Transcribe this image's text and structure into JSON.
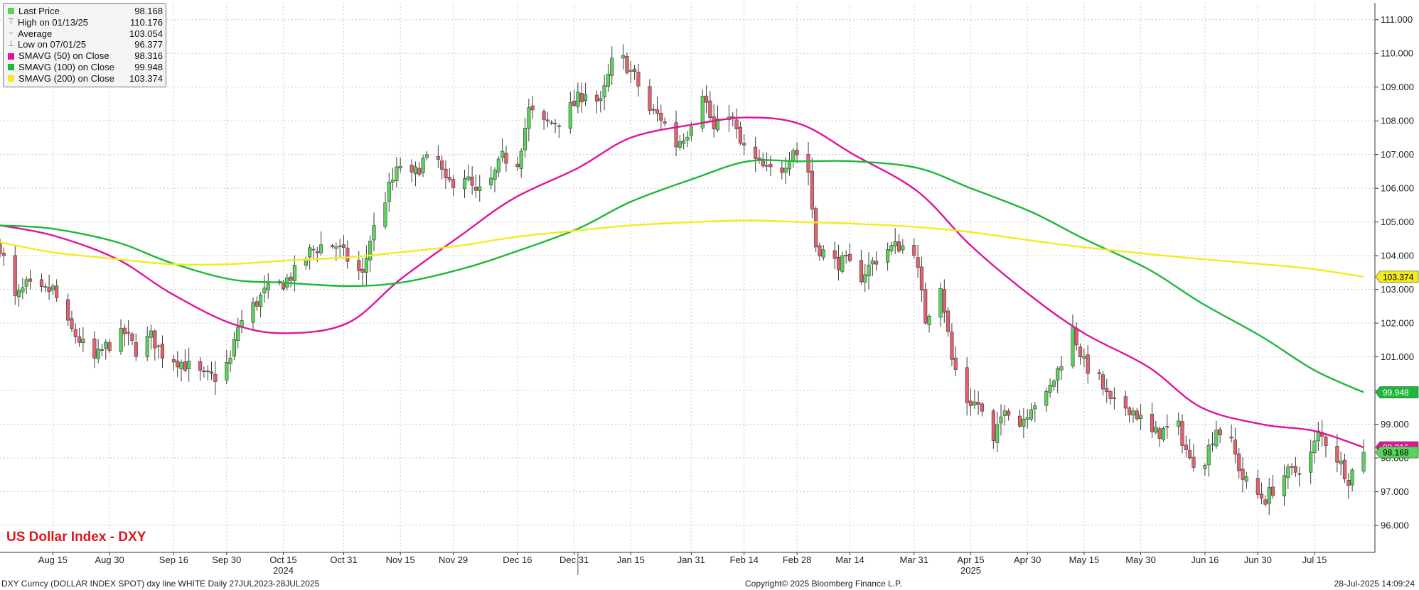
{
  "legend": {
    "items": [
      {
        "label": "Last Price",
        "value": "98.168",
        "color": "#5bd35b",
        "icon": "square"
      },
      {
        "label": "High on 01/13/25",
        "value": "110.176",
        "icon": "high-marker"
      },
      {
        "label": "Average",
        "value": "103.054",
        "icon": "average-marker"
      },
      {
        "label": "Low on 07/01/25",
        "value": "96.377",
        "icon": "low-marker"
      },
      {
        "label": "SMAVG (50)  on Close",
        "value": "98.316",
        "color": "#e0149a",
        "icon": "square"
      },
      {
        "label": "SMAVG (100)  on Close",
        "value": "99.948",
        "color": "#1cb83a",
        "icon": "square"
      },
      {
        "label": "SMAVG (200)  on Close",
        "value": "103.374",
        "color": "#f2ec1c",
        "icon": "square"
      }
    ]
  },
  "chart_title": "US Dollar Index - DXY",
  "footer": {
    "left": "DXY Curncy (DOLLAR INDEX SPOT) dxy line WHITE  Daily 27JUL2023-28JUL2025",
    "center": "Copyright© 2025 Bloomberg Finance L.P.",
    "right": "28-Jul-2025 14:09:24"
  },
  "colors": {
    "up": "#5bd35b",
    "down": "#e4606c",
    "sma50": "#e0149a",
    "sma100": "#1cb83a",
    "sma200": "#f2ec1c",
    "title": "#e0161d"
  },
  "chart_data": {
    "type": "candlestick",
    "title": "US Dollar Index - DXY",
    "ylim": [
      95.2,
      111.5
    ],
    "yticks": [
      "96.000",
      "97.000",
      "98.000",
      "99.000",
      "100.000",
      "101.000",
      "102.000",
      "103.000",
      "104.000",
      "105.000",
      "106.000",
      "107.000",
      "108.000",
      "109.000",
      "110.000",
      "111.000"
    ],
    "xlim": [
      "2024-08-01",
      "2025-07-31"
    ],
    "xticks": [
      {
        "date": "2024-08-15",
        "label": "Aug 15"
      },
      {
        "date": "2024-08-30",
        "label": "Aug 30"
      },
      {
        "date": "2024-09-16",
        "label": "Sep 16"
      },
      {
        "date": "2024-09-30",
        "label": "Sep 30"
      },
      {
        "date": "2024-10-15",
        "label": "Oct 15",
        "year": "2024"
      },
      {
        "date": "2024-10-31",
        "label": "Oct 31"
      },
      {
        "date": "2024-11-15",
        "label": "Nov 15"
      },
      {
        "date": "2024-11-29",
        "label": "Nov 29"
      },
      {
        "date": "2024-12-16",
        "label": "Dec 16"
      },
      {
        "date": "2024-12-31",
        "label": "Dec 31"
      },
      {
        "date": "2025-01-15",
        "label": "Jan 15"
      },
      {
        "date": "2025-01-31",
        "label": "Jan 31"
      },
      {
        "date": "2025-02-14",
        "label": "Feb 14"
      },
      {
        "date": "2025-02-28",
        "label": "Feb 28"
      },
      {
        "date": "2025-03-14",
        "label": "Mar 14"
      },
      {
        "date": "2025-03-31",
        "label": "Mar 31"
      },
      {
        "date": "2025-04-15",
        "label": "Apr 15",
        "year": "2025"
      },
      {
        "date": "2025-04-30",
        "label": "Apr 30"
      },
      {
        "date": "2025-05-15",
        "label": "May 15"
      },
      {
        "date": "2025-05-30",
        "label": "May 30"
      },
      {
        "date": "2025-06-16",
        "label": "Jun 16"
      },
      {
        "date": "2025-06-30",
        "label": "Jun 30"
      },
      {
        "date": "2025-07-15",
        "label": "Jul 15"
      }
    ],
    "close_anchors": [
      [
        "2024-08-01",
        104.3
      ],
      [
        "2024-08-05",
        102.7
      ],
      [
        "2024-08-08",
        103.1
      ],
      [
        "2024-08-12",
        102.9
      ],
      [
        "2024-08-15",
        103.0
      ],
      [
        "2024-08-19",
        101.9
      ],
      [
        "2024-08-22",
        101.5
      ],
      [
        "2024-08-26",
        100.9
      ],
      [
        "2024-08-29",
        101.3
      ],
      [
        "2024-09-03",
        101.7
      ],
      [
        "2024-09-06",
        101.2
      ],
      [
        "2024-09-10",
        101.6
      ],
      [
        "2024-09-13",
        101.1
      ],
      [
        "2024-09-17",
        100.9
      ],
      [
        "2024-09-20",
        100.7
      ],
      [
        "2024-09-24",
        100.4
      ],
      [
        "2024-09-27",
        100.4
      ],
      [
        "2024-10-01",
        100.9
      ],
      [
        "2024-10-03",
        101.9
      ],
      [
        "2024-10-07",
        102.5
      ],
      [
        "2024-10-10",
        102.9
      ],
      [
        "2024-10-15",
        103.2
      ],
      [
        "2024-10-18",
        103.5
      ],
      [
        "2024-10-22",
        104.1
      ],
      [
        "2024-10-25",
        104.3
      ],
      [
        "2024-10-29",
        104.3
      ],
      [
        "2024-11-01",
        103.9
      ],
      [
        "2024-11-05",
        103.4
      ],
      [
        "2024-11-07",
        104.5
      ],
      [
        "2024-11-12",
        106.0
      ],
      [
        "2024-11-15",
        106.7
      ],
      [
        "2024-11-18",
        106.3
      ],
      [
        "2024-11-21",
        106.8
      ],
      [
        "2024-11-25",
        106.8
      ],
      [
        "2024-11-27",
        106.1
      ],
      [
        "2024-12-02",
        106.4
      ],
      [
        "2024-12-05",
        105.8
      ],
      [
        "2024-12-09",
        106.2
      ],
      [
        "2024-12-12",
        106.9
      ],
      [
        "2024-12-16",
        106.8
      ],
      [
        "2024-12-19",
        108.3
      ],
      [
        "2024-12-23",
        107.9
      ],
      [
        "2024-12-27",
        108.0
      ],
      [
        "2024-12-31",
        108.5
      ],
      [
        "2025-01-03",
        108.9
      ],
      [
        "2025-01-07",
        108.5
      ],
      [
        "2025-01-10",
        109.7
      ],
      [
        "2025-01-13",
        109.8
      ],
      [
        "2025-01-16",
        109.3
      ],
      [
        "2025-01-20",
        108.3
      ],
      [
        "2025-01-23",
        108.1
      ],
      [
        "2025-01-27",
        107.3
      ],
      [
        "2025-01-30",
        107.7
      ],
      [
        "2025-02-03",
        108.9
      ],
      [
        "2025-02-06",
        107.7
      ],
      [
        "2025-02-10",
        108.3
      ],
      [
        "2025-02-13",
        107.3
      ],
      [
        "2025-02-17",
        106.8
      ],
      [
        "2025-02-20",
        106.5
      ],
      [
        "2025-02-24",
        106.6
      ],
      [
        "2025-02-27",
        107.2
      ],
      [
        "2025-03-03",
        106.5
      ],
      [
        "2025-03-05",
        104.3
      ],
      [
        "2025-03-10",
        103.8
      ],
      [
        "2025-03-13",
        103.8
      ],
      [
        "2025-03-17",
        103.4
      ],
      [
        "2025-03-20",
        103.8
      ],
      [
        "2025-03-24",
        104.2
      ],
      [
        "2025-03-27",
        104.3
      ],
      [
        "2025-03-31",
        104.2
      ],
      [
        "2025-04-03",
        102.1
      ],
      [
        "2025-04-07",
        103.2
      ],
      [
        "2025-04-10",
        100.9
      ],
      [
        "2025-04-14",
        99.7
      ],
      [
        "2025-04-17",
        99.6
      ],
      [
        "2025-04-21",
        98.4
      ],
      [
        "2025-04-24",
        99.6
      ],
      [
        "2025-04-28",
        99.0
      ],
      [
        "2025-05-01",
        99.6
      ],
      [
        "2025-05-05",
        99.8
      ],
      [
        "2025-05-08",
        100.6
      ],
      [
        "2025-05-12",
        101.8
      ],
      [
        "2025-05-15",
        100.8
      ],
      [
        "2025-05-19",
        100.3
      ],
      [
        "2025-05-22",
        99.6
      ],
      [
        "2025-05-27",
        99.5
      ],
      [
        "2025-05-29",
        99.3
      ],
      [
        "2025-06-02",
        98.7
      ],
      [
        "2025-06-05",
        98.8
      ],
      [
        "2025-06-09",
        98.9
      ],
      [
        "2025-06-12",
        97.9
      ],
      [
        "2025-06-16",
        98.0
      ],
      [
        "2025-06-19",
        98.9
      ],
      [
        "2025-06-23",
        98.4
      ],
      [
        "2025-06-26",
        97.4
      ],
      [
        "2025-06-30",
        96.9
      ],
      [
        "2025-07-02",
        96.8
      ],
      [
        "2025-07-07",
        97.5
      ],
      [
        "2025-07-10",
        97.6
      ],
      [
        "2025-07-14",
        98.1
      ],
      [
        "2025-07-16",
        98.7
      ],
      [
        "2025-07-18",
        98.5
      ],
      [
        "2025-07-21",
        98.0
      ],
      [
        "2025-07-24",
        97.4
      ],
      [
        "2025-07-25",
        97.6
      ],
      [
        "2025-07-28",
        98.168
      ]
    ],
    "series": [
      {
        "name": "SMAVG (50)  on Close",
        "color": "#e0149a",
        "x": [
          "2024-08-01",
          "2024-08-15",
          "2024-09-01",
          "2024-09-15",
          "2024-10-01",
          "2024-10-15",
          "2024-11-01",
          "2024-11-15",
          "2024-12-01",
          "2024-12-15",
          "2025-01-01",
          "2025-01-15",
          "2025-02-01",
          "2025-02-15",
          "2025-03-01",
          "2025-03-15",
          "2025-04-01",
          "2025-04-15",
          "2025-05-01",
          "2025-05-15",
          "2025-06-01",
          "2025-06-15",
          "2025-07-01",
          "2025-07-15",
          "2025-07-28"
        ],
        "values": [
          104.9,
          104.6,
          103.9,
          102.9,
          102.0,
          101.7,
          102.0,
          103.3,
          104.6,
          105.7,
          106.6,
          107.5,
          107.9,
          108.1,
          107.9,
          107.0,
          105.9,
          104.3,
          102.8,
          101.7,
          100.7,
          99.5,
          99.0,
          98.8,
          98.316
        ]
      },
      {
        "name": "SMAVG (100)  on Close",
        "color": "#1cb83a",
        "x": [
          "2024-08-01",
          "2024-08-15",
          "2024-09-01",
          "2024-09-15",
          "2024-10-01",
          "2024-10-15",
          "2024-11-01",
          "2024-11-15",
          "2024-12-01",
          "2024-12-15",
          "2025-01-01",
          "2025-01-15",
          "2025-02-01",
          "2025-02-15",
          "2025-03-01",
          "2025-03-15",
          "2025-04-01",
          "2025-04-15",
          "2025-05-01",
          "2025-05-15",
          "2025-06-01",
          "2025-06-15",
          "2025-07-01",
          "2025-07-15",
          "2025-07-28"
        ],
        "values": [
          104.9,
          104.8,
          104.4,
          103.8,
          103.3,
          103.2,
          103.1,
          103.2,
          103.6,
          104.1,
          104.8,
          105.6,
          106.3,
          106.8,
          106.8,
          106.8,
          106.6,
          106.0,
          105.3,
          104.5,
          103.6,
          102.6,
          101.6,
          100.6,
          99.948
        ]
      },
      {
        "name": "SMAVG (200)  on Close",
        "color": "#f2ec1c",
        "x": [
          "2024-08-01",
          "2024-08-15",
          "2024-09-01",
          "2024-09-15",
          "2024-10-01",
          "2024-10-15",
          "2024-11-01",
          "2024-11-15",
          "2024-12-01",
          "2024-12-15",
          "2025-01-01",
          "2025-01-15",
          "2025-02-01",
          "2025-02-15",
          "2025-03-01",
          "2025-03-15",
          "2025-04-01",
          "2025-04-15",
          "2025-05-01",
          "2025-05-15",
          "2025-06-01",
          "2025-06-15",
          "2025-07-01",
          "2025-07-15",
          "2025-07-28"
        ],
        "values": [
          104.4,
          104.1,
          103.9,
          103.75,
          103.75,
          103.85,
          103.95,
          104.1,
          104.3,
          104.55,
          104.75,
          104.9,
          105.0,
          105.05,
          105.0,
          104.95,
          104.85,
          104.7,
          104.45,
          104.25,
          104.05,
          103.9,
          103.75,
          103.6,
          103.374
        ]
      }
    ],
    "last_labels": [
      {
        "value": 103.374,
        "text": "103.374",
        "bg": "#f2ec1c",
        "fg": "#000"
      },
      {
        "value": 99.948,
        "text": "99.948",
        "bg": "#1cb83a",
        "fg": "#fff"
      },
      {
        "value": 98.316,
        "text": "98.316",
        "bg": "#e0149a",
        "fg": "#fff"
      },
      {
        "value": 98.168,
        "text": "98.168",
        "bg": "#5bd35b",
        "fg": "#000"
      }
    ],
    "grid": true
  }
}
